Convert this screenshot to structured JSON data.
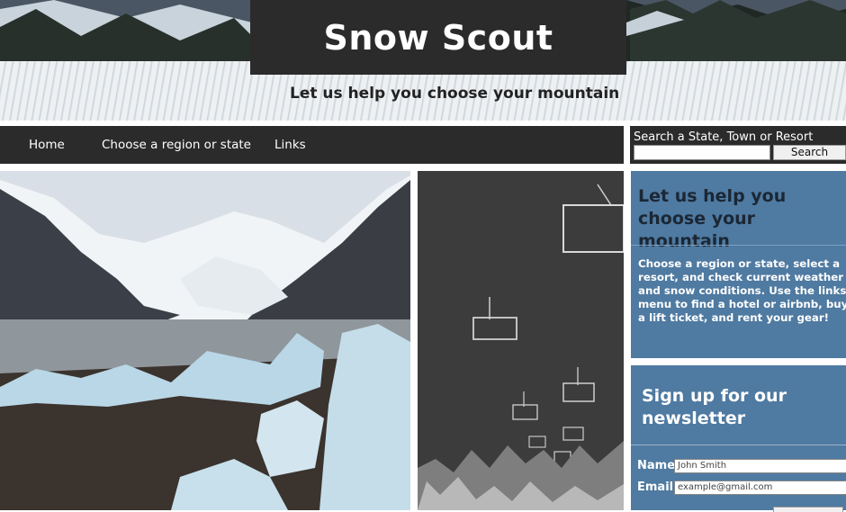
{
  "header": {
    "title": "Snow Scout",
    "tagline": "Let us help you choose your mountain"
  },
  "nav": {
    "items": [
      {
        "label": "Home"
      },
      {
        "label": "Choose a region or state"
      },
      {
        "label": "Links"
      }
    ]
  },
  "search": {
    "label": "Search a State, Town or Resort",
    "value": "",
    "button": "Search"
  },
  "intro_panel": {
    "heading": "Let us help you choose your mountain",
    "body": "Choose a region or state, select a resort, and check current weather and snow conditions. Use the links menu to find a hotel or airbnb, buy a lift ticket, and rent your gear!"
  },
  "newsletter": {
    "heading": "Sign up for our newsletter",
    "name_label": "Name",
    "name_placeholder": "John Smith",
    "email_label": "Email",
    "email_placeholder": "example@gmail.com"
  },
  "colors": {
    "dark_bar": "#2b2b2b",
    "panel_blue": "#4f7aa1"
  }
}
